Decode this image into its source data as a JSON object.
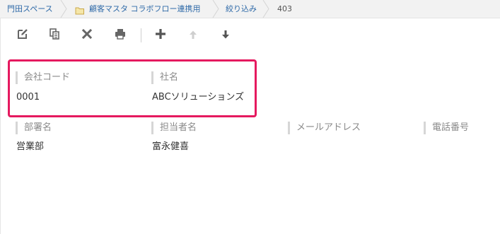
{
  "breadcrumb": {
    "items": [
      {
        "label": "門田スペース"
      },
      {
        "label": "顧客マスタ コラボフロー連携用"
      },
      {
        "label": "絞り込み"
      },
      {
        "label": "403"
      }
    ]
  },
  "toolbar": {
    "buttons": [
      {
        "icon": "edit-icon"
      },
      {
        "icon": "copy-icon"
      },
      {
        "icon": "delete-icon"
      },
      {
        "icon": "print-icon"
      },
      {
        "icon": "add-icon"
      },
      {
        "icon": "arrow-up-icon"
      },
      {
        "icon": "arrow-down-icon"
      }
    ]
  },
  "record": {
    "fields": [
      {
        "label": "会社コード",
        "value": "0001"
      },
      {
        "label": "社名",
        "value": "ABCソリューションズ"
      },
      {
        "label": "部署名",
        "value": "営業部"
      },
      {
        "label": "担当者名",
        "value": "富永健喜"
      },
      {
        "label": "メールアドレス",
        "value": ""
      },
      {
        "label": "電話番号",
        "value": ""
      }
    ]
  },
  "colors": {
    "highlight": "#e5195f",
    "link": "#2f6aa8",
    "label": "#8a8a8a"
  }
}
